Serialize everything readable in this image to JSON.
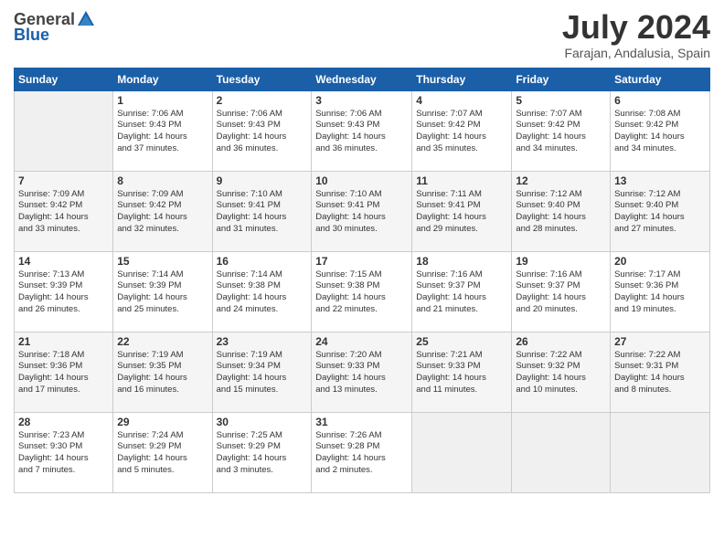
{
  "logo": {
    "general": "General",
    "blue": "Blue"
  },
  "title": "July 2024",
  "subtitle": "Farajan, Andalusia, Spain",
  "headers": [
    "Sunday",
    "Monday",
    "Tuesday",
    "Wednesday",
    "Thursday",
    "Friday",
    "Saturday"
  ],
  "weeks": [
    [
      {
        "day": "",
        "info": ""
      },
      {
        "day": "1",
        "info": "Sunrise: 7:06 AM\nSunset: 9:43 PM\nDaylight: 14 hours\nand 37 minutes."
      },
      {
        "day": "2",
        "info": "Sunrise: 7:06 AM\nSunset: 9:43 PM\nDaylight: 14 hours\nand 36 minutes."
      },
      {
        "day": "3",
        "info": "Sunrise: 7:06 AM\nSunset: 9:43 PM\nDaylight: 14 hours\nand 36 minutes."
      },
      {
        "day": "4",
        "info": "Sunrise: 7:07 AM\nSunset: 9:42 PM\nDaylight: 14 hours\nand 35 minutes."
      },
      {
        "day": "5",
        "info": "Sunrise: 7:07 AM\nSunset: 9:42 PM\nDaylight: 14 hours\nand 34 minutes."
      },
      {
        "day": "6",
        "info": "Sunrise: 7:08 AM\nSunset: 9:42 PM\nDaylight: 14 hours\nand 34 minutes."
      }
    ],
    [
      {
        "day": "7",
        "info": "Sunrise: 7:09 AM\nSunset: 9:42 PM\nDaylight: 14 hours\nand 33 minutes."
      },
      {
        "day": "8",
        "info": "Sunrise: 7:09 AM\nSunset: 9:42 PM\nDaylight: 14 hours\nand 32 minutes."
      },
      {
        "day": "9",
        "info": "Sunrise: 7:10 AM\nSunset: 9:41 PM\nDaylight: 14 hours\nand 31 minutes."
      },
      {
        "day": "10",
        "info": "Sunrise: 7:10 AM\nSunset: 9:41 PM\nDaylight: 14 hours\nand 30 minutes."
      },
      {
        "day": "11",
        "info": "Sunrise: 7:11 AM\nSunset: 9:41 PM\nDaylight: 14 hours\nand 29 minutes."
      },
      {
        "day": "12",
        "info": "Sunrise: 7:12 AM\nSunset: 9:40 PM\nDaylight: 14 hours\nand 28 minutes."
      },
      {
        "day": "13",
        "info": "Sunrise: 7:12 AM\nSunset: 9:40 PM\nDaylight: 14 hours\nand 27 minutes."
      }
    ],
    [
      {
        "day": "14",
        "info": "Sunrise: 7:13 AM\nSunset: 9:39 PM\nDaylight: 14 hours\nand 26 minutes."
      },
      {
        "day": "15",
        "info": "Sunrise: 7:14 AM\nSunset: 9:39 PM\nDaylight: 14 hours\nand 25 minutes."
      },
      {
        "day": "16",
        "info": "Sunrise: 7:14 AM\nSunset: 9:38 PM\nDaylight: 14 hours\nand 24 minutes."
      },
      {
        "day": "17",
        "info": "Sunrise: 7:15 AM\nSunset: 9:38 PM\nDaylight: 14 hours\nand 22 minutes."
      },
      {
        "day": "18",
        "info": "Sunrise: 7:16 AM\nSunset: 9:37 PM\nDaylight: 14 hours\nand 21 minutes."
      },
      {
        "day": "19",
        "info": "Sunrise: 7:16 AM\nSunset: 9:37 PM\nDaylight: 14 hours\nand 20 minutes."
      },
      {
        "day": "20",
        "info": "Sunrise: 7:17 AM\nSunset: 9:36 PM\nDaylight: 14 hours\nand 19 minutes."
      }
    ],
    [
      {
        "day": "21",
        "info": "Sunrise: 7:18 AM\nSunset: 9:36 PM\nDaylight: 14 hours\nand 17 minutes."
      },
      {
        "day": "22",
        "info": "Sunrise: 7:19 AM\nSunset: 9:35 PM\nDaylight: 14 hours\nand 16 minutes."
      },
      {
        "day": "23",
        "info": "Sunrise: 7:19 AM\nSunset: 9:34 PM\nDaylight: 14 hours\nand 15 minutes."
      },
      {
        "day": "24",
        "info": "Sunrise: 7:20 AM\nSunset: 9:33 PM\nDaylight: 14 hours\nand 13 minutes."
      },
      {
        "day": "25",
        "info": "Sunrise: 7:21 AM\nSunset: 9:33 PM\nDaylight: 14 hours\nand 11 minutes."
      },
      {
        "day": "26",
        "info": "Sunrise: 7:22 AM\nSunset: 9:32 PM\nDaylight: 14 hours\nand 10 minutes."
      },
      {
        "day": "27",
        "info": "Sunrise: 7:22 AM\nSunset: 9:31 PM\nDaylight: 14 hours\nand 8 minutes."
      }
    ],
    [
      {
        "day": "28",
        "info": "Sunrise: 7:23 AM\nSunset: 9:30 PM\nDaylight: 14 hours\nand 7 minutes."
      },
      {
        "day": "29",
        "info": "Sunrise: 7:24 AM\nSunset: 9:29 PM\nDaylight: 14 hours\nand 5 minutes."
      },
      {
        "day": "30",
        "info": "Sunrise: 7:25 AM\nSunset: 9:29 PM\nDaylight: 14 hours\nand 3 minutes."
      },
      {
        "day": "31",
        "info": "Sunrise: 7:26 AM\nSunset: 9:28 PM\nDaylight: 14 hours\nand 2 minutes."
      },
      {
        "day": "",
        "info": ""
      },
      {
        "day": "",
        "info": ""
      },
      {
        "day": "",
        "info": ""
      }
    ]
  ]
}
